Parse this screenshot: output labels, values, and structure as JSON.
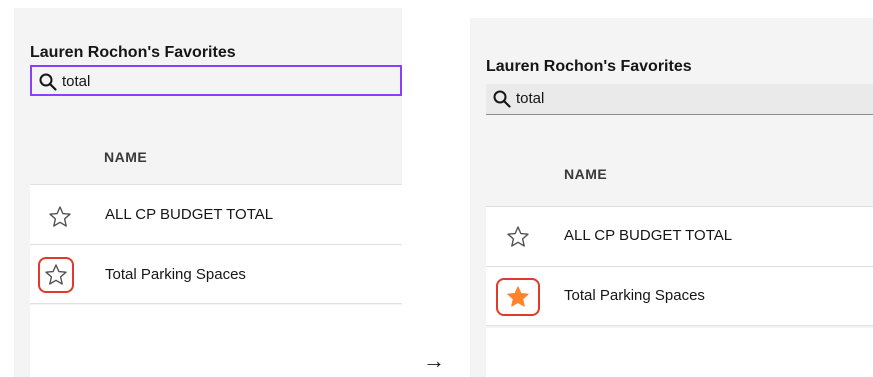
{
  "before": {
    "title": "Lauren Rochon's Favorites",
    "search": {
      "value": "total",
      "icon": "search-icon"
    },
    "column_header": "NAME",
    "rows": [
      {
        "label": "ALL CP BUDGET TOTAL",
        "favorite": false,
        "icon": "star-outline-icon"
      },
      {
        "label": "Total Parking Spaces",
        "favorite": false,
        "icon": "star-outline-icon",
        "highlighted": true
      }
    ]
  },
  "transition_arrow": "→",
  "after": {
    "title": "Lauren Rochon's Favorites",
    "search": {
      "value": "total",
      "icon": "search-icon"
    },
    "column_header": "NAME",
    "rows": [
      {
        "label": "ALL CP BUDGET TOTAL",
        "favorite": false,
        "icon": "star-outline-icon"
      },
      {
        "label": "Total Parking Spaces",
        "favorite": true,
        "icon": "star-filled-icon",
        "highlighted": true
      }
    ]
  },
  "colors": {
    "focus_border": "#8a3ffc",
    "highlight_ring": "#e03a2a",
    "favorite_star": "#ff832b"
  }
}
